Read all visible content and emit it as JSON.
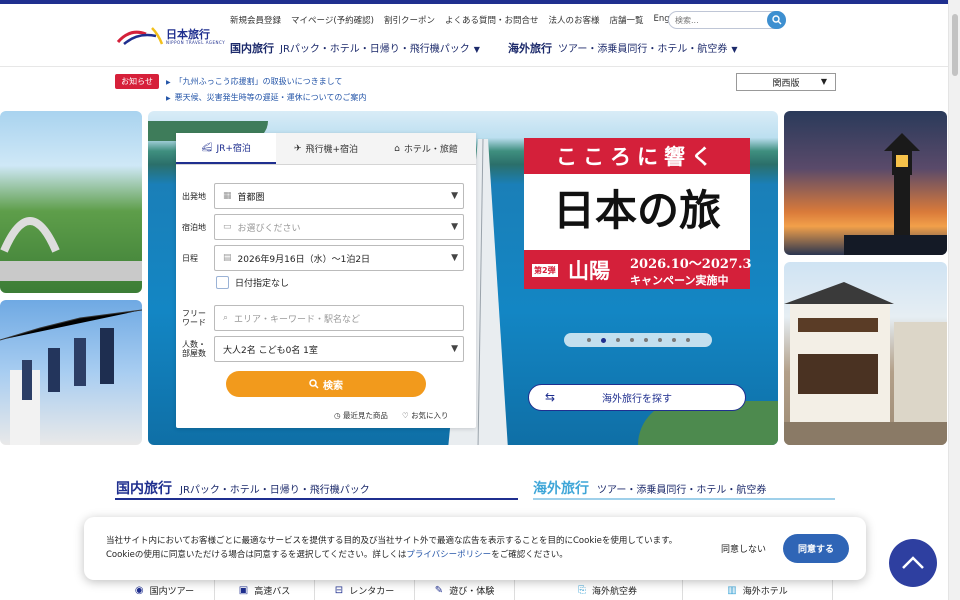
{
  "header": {
    "logo_text": "日本旅行",
    "logo_sub": "NIPPON TRAVEL AGENCY",
    "utility_links": [
      "新規会員登録",
      "マイページ(予約確認)",
      "割引クーポン",
      "よくある質問・お問合せ",
      "法人のお客様",
      "店舗一覧",
      "English"
    ],
    "search_placeholder": "検索...",
    "nav": {
      "domestic_label": "国内旅行",
      "domestic_items": "JRパック・ホテル・日帰り・飛行機パック",
      "overseas_label": "海外旅行",
      "overseas_items": "ツアー・添乗員同行・ホテル・航空券"
    }
  },
  "notices": {
    "tag": "お知らせ",
    "items": [
      "「九州ふっこう応援割」の取扱いにつきまして",
      "悪天候、災害発生時等の遅延・運休についてのご案内"
    ]
  },
  "region_select": "関西版",
  "search_panel": {
    "tabs": [
      "JR+宿泊",
      "飛行機+宿泊",
      "ホテル・旅館"
    ],
    "fields": {
      "departure_label": "出発地",
      "departure_value": "首都圏",
      "lodging_label": "宿泊地",
      "lodging_placeholder": "お選びください",
      "date_label": "日程",
      "date_value": "2026年9月16日（水）～1泊2日",
      "no_date_label": "日付指定なし",
      "freeword_label_1": "フリー",
      "freeword_label_2": "ワード",
      "freeword_placeholder": "エリア・キーワード・駅名など",
      "people_label_1": "人数・",
      "people_label_2": "部屋数",
      "people_value": "大人2名 こども0名 1室"
    },
    "submit_label": "検索",
    "recent_label": "最近見た商品",
    "favorite_label": "お気に入り"
  },
  "hero": {
    "poster_top": "こころに響く",
    "poster_main": "日本の旅",
    "poster_edition": "第2弾",
    "poster_region": "山陽",
    "poster_dates": "2026.10～2027.3",
    "poster_campaign": "キャンペーン実施中",
    "overseas_button": "海外旅行を探す",
    "slide_count": 8,
    "active_slide": 2
  },
  "sections": {
    "domestic_title": "国内旅行",
    "domestic_sub": "JRパック・ホテル・日帰り・飛行機パック",
    "overseas_title": "海外旅行",
    "overseas_sub": "ツアー・添乗員同行・ホテル・航空券",
    "domestic_grid": [
      "国内ツアー",
      "高速バス",
      "レンタカー",
      "遊び・体験"
    ],
    "overseas_grid": [
      "海外航空券",
      "海外ホテル"
    ]
  },
  "cookie": {
    "text_1": "当社サイト内においてお客様ごとに最適なサービスを提供する目的及び当社サイト外で最適な広告を表示することを目的にCookieを使用しています。Cookieの使用に同意いただける場合は同意するを選択してください。詳しくは",
    "link": "プライバシーポリシー",
    "text_2": "をご確認ください。",
    "decline": "同意しない",
    "accept": "同意する"
  },
  "colors": {
    "brand_navy": "#1f2f8f",
    "accent_orange": "#f29a1c",
    "notice_red": "#d6203a",
    "overseas_blue": "#3fa6d8"
  }
}
